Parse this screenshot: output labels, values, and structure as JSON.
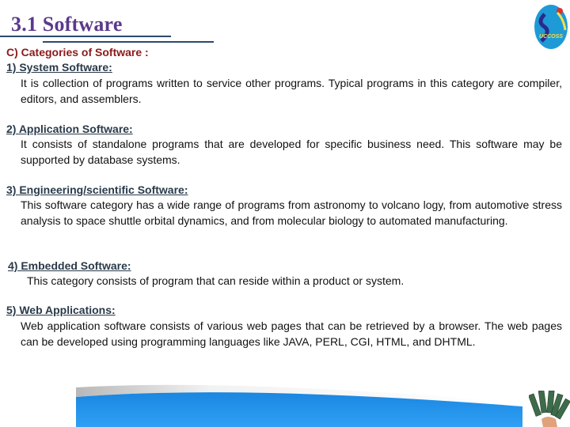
{
  "slide": {
    "title": "3.1 Software",
    "subtitle": "C) Categories of Software :",
    "logo_text": "UCCOSS",
    "sections": [
      {
        "heading": "1) System Software:",
        "body": "It is collection of programs written to service other programs. Typical programs in this category are compiler, editors, and assemblers."
      },
      {
        "heading": "2) Application Software:",
        "body": "It consists of standalone programs that are developed for specific business need. This software may be supported by database systems."
      },
      {
        "heading": "3) Engineering/scientific Software:",
        "body": "This software category has a wide range of programs from astronomy to volcano logy, from automotive stress analysis to space shuttle orbital dynamics, and from molecular biology to automated manufacturing."
      },
      {
        "heading": "4) Embedded Software:",
        "body": "This category consists of program that can reside within a product or system."
      },
      {
        "heading": "5) Web Applications:",
        "body": "Web application software consists of various web pages that can be retrieved by a browser. The web pages can be developed using programming languages like JAVA, PERL, CGI, HTML, and DHTML."
      }
    ]
  },
  "colors": {
    "title": "#5a3a8c",
    "subtitle": "#8b1a1a",
    "heading": "#2a3a4a",
    "rule": "#2d4a6b",
    "banner_blue": "#1f8fe8"
  }
}
